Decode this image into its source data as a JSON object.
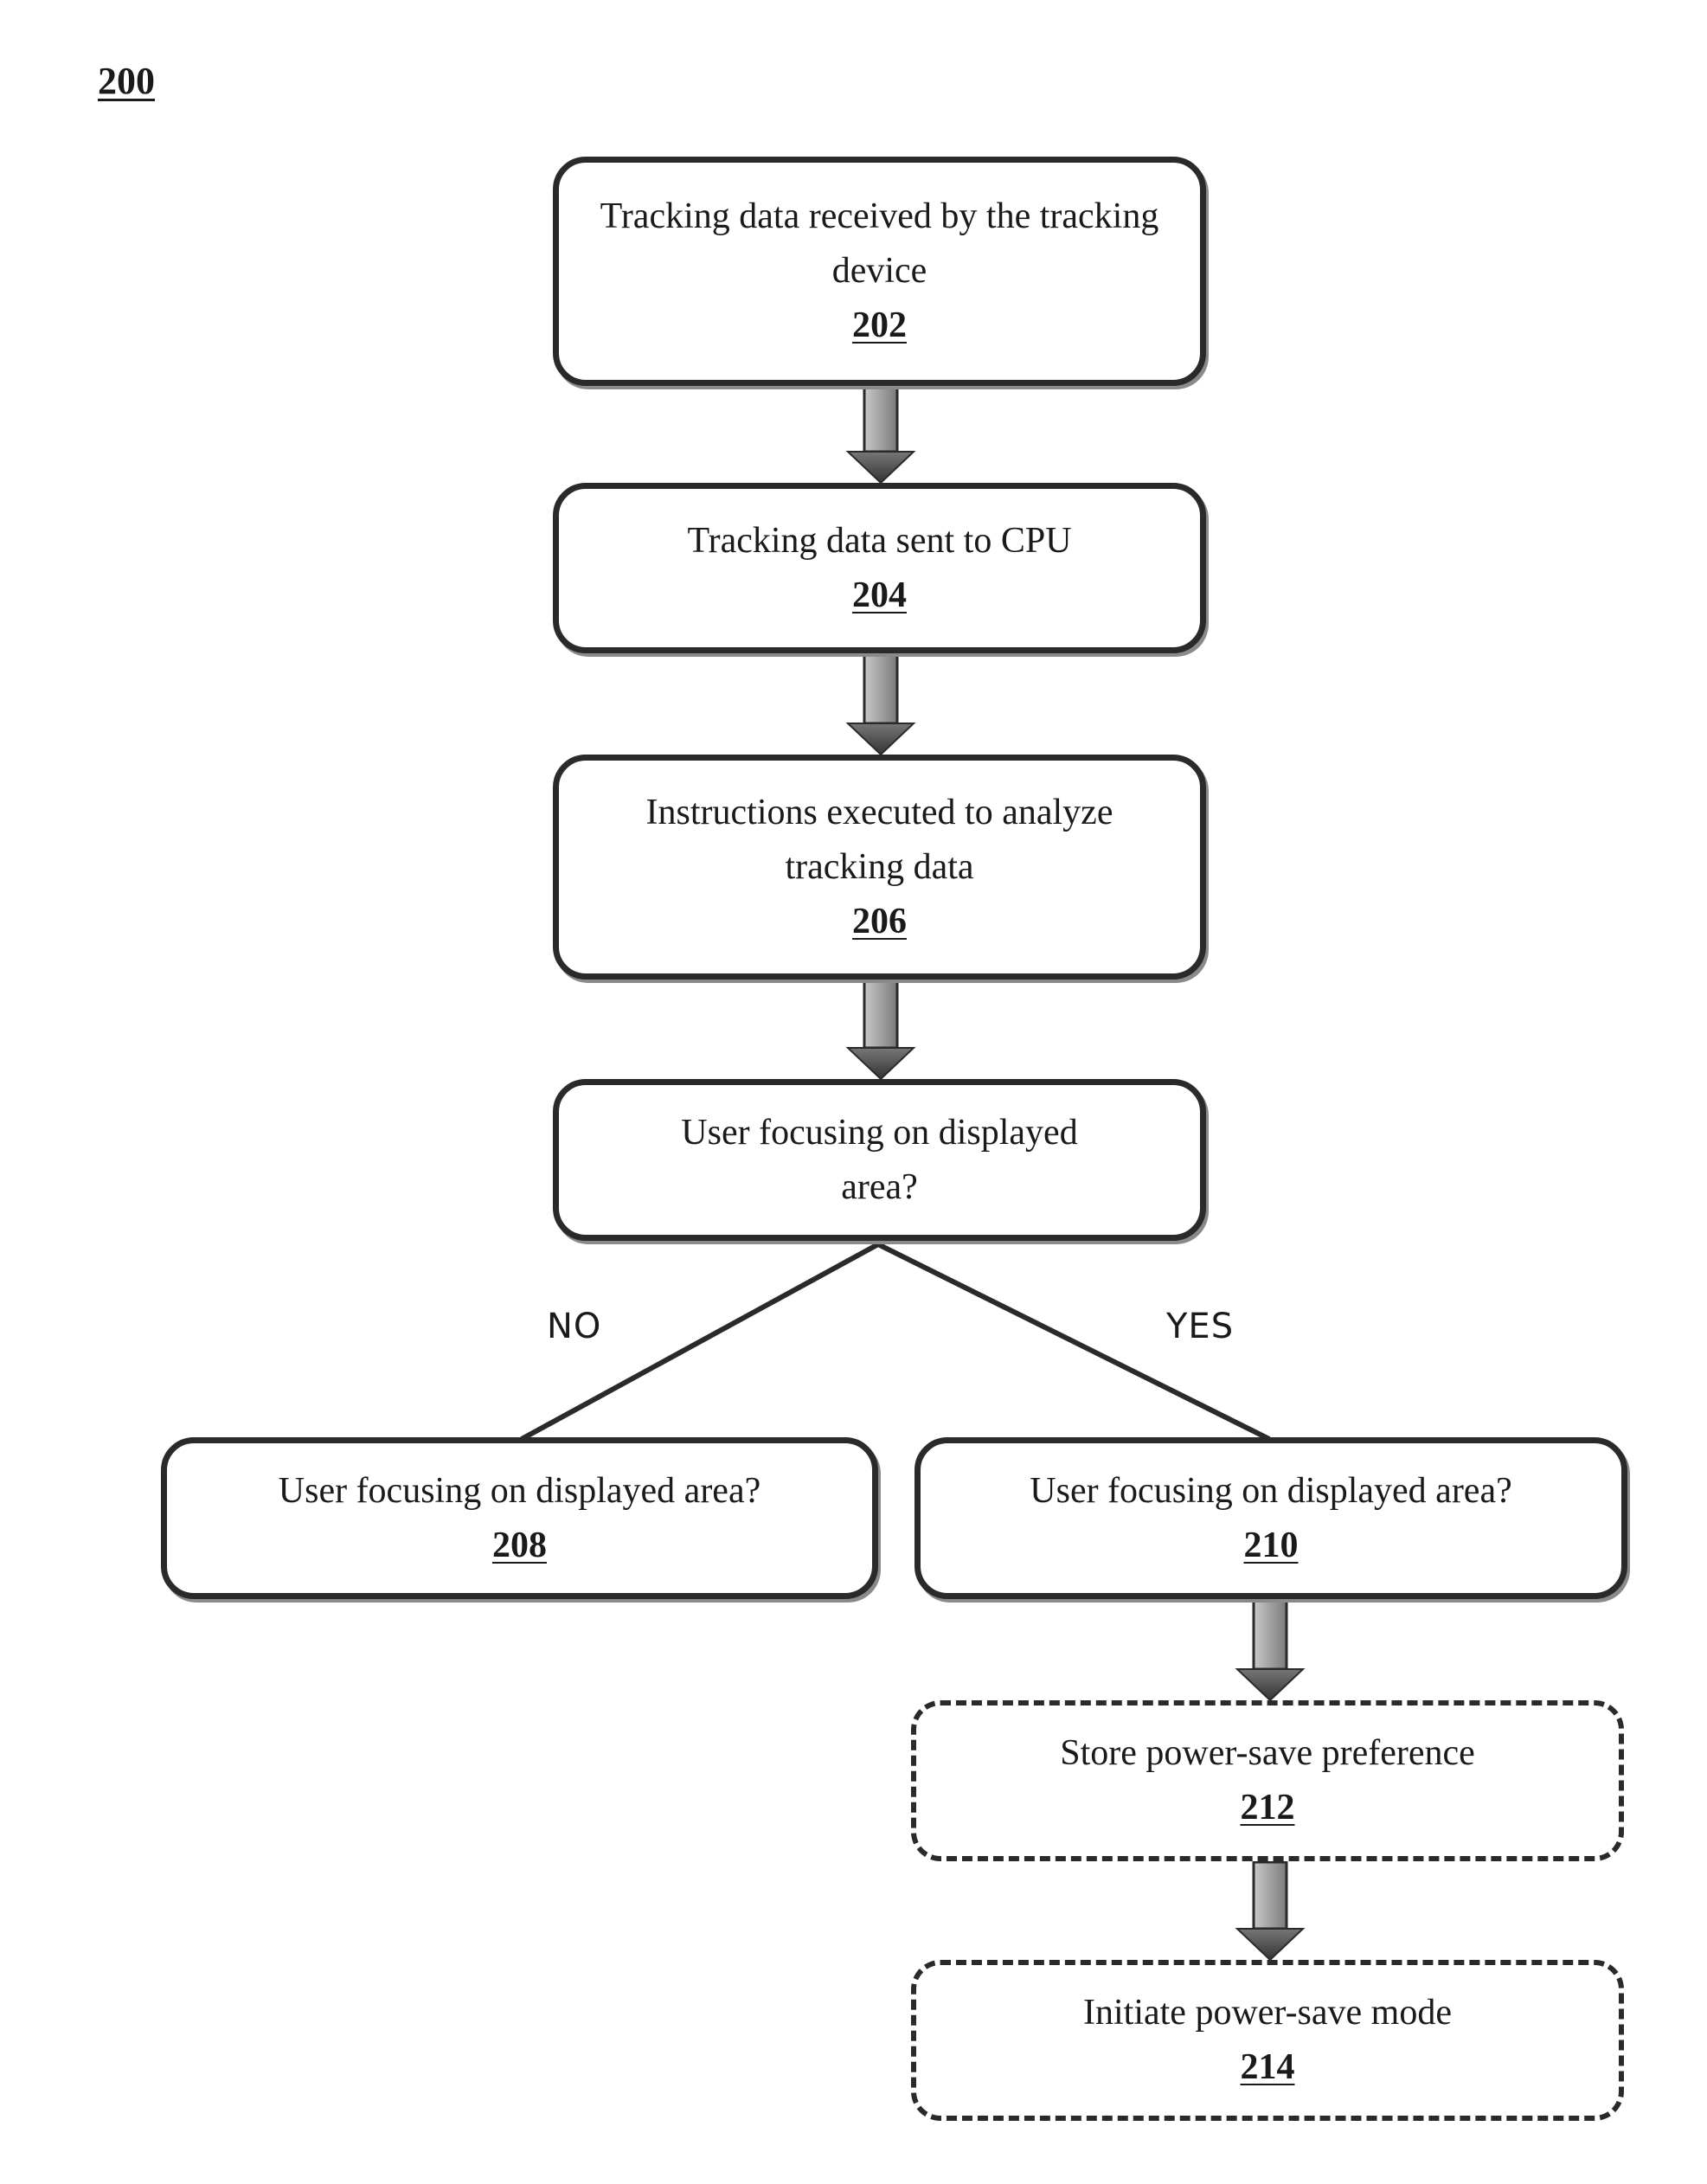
{
  "figure_label": "200",
  "steps": [
    {
      "id": "202",
      "text": "Tracking data received by the tracking device",
      "number": "202",
      "style": "solid"
    },
    {
      "id": "204",
      "text": "Tracking data sent to CPU",
      "number": "204",
      "style": "solid"
    },
    {
      "id": "206",
      "text": "Instructions executed to analyze tracking data",
      "number": "206",
      "style": "solid"
    },
    {
      "id": "decision",
      "text": "User focusing on displayed area?",
      "number": "",
      "style": "solid"
    },
    {
      "id": "208",
      "text": "User focusing on displayed area?",
      "number": "208",
      "style": "solid"
    },
    {
      "id": "210",
      "text": "User focusing on displayed area?",
      "number": "210",
      "style": "solid"
    },
    {
      "id": "212",
      "text": "Store power-save preference",
      "number": "212",
      "style": "dashed"
    },
    {
      "id": "214",
      "text": "Initiate power-save mode",
      "number": "214",
      "style": "dashed"
    }
  ],
  "branches": {
    "no_label": "NO",
    "yes_label": "YES"
  },
  "connections": [
    {
      "from": "202",
      "to": "204",
      "type": "arrow"
    },
    {
      "from": "204",
      "to": "206",
      "type": "arrow"
    },
    {
      "from": "206",
      "to": "decision",
      "type": "arrow"
    },
    {
      "from": "decision",
      "to": "208",
      "type": "line",
      "label": "NO"
    },
    {
      "from": "decision",
      "to": "210",
      "type": "line",
      "label": "YES"
    },
    {
      "from": "210",
      "to": "212",
      "type": "arrow"
    },
    {
      "from": "212",
      "to": "214",
      "type": "arrow"
    }
  ],
  "colors": {
    "stroke": "#2a2a2a",
    "arrow_light": "#bdbdbd",
    "arrow_dark": "#4a4a4a",
    "background": "#ffffff"
  }
}
